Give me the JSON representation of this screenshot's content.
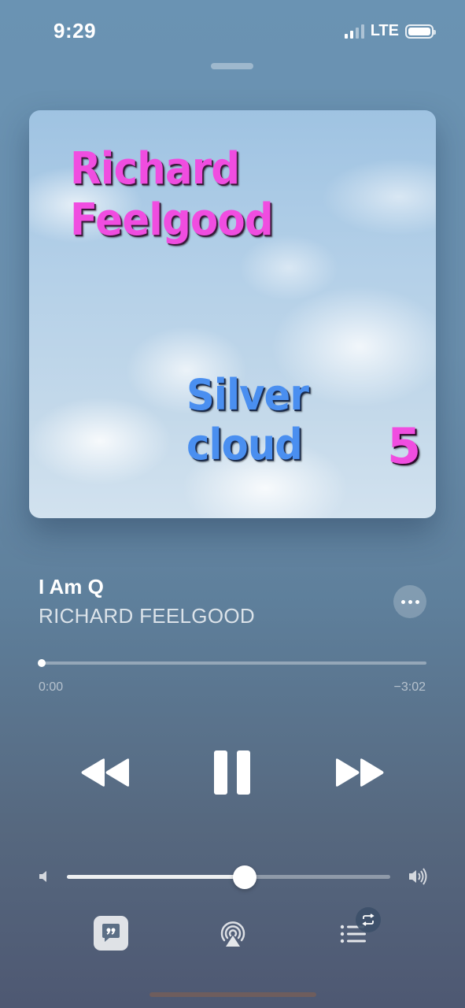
{
  "status_bar": {
    "time": "9:29",
    "network": "LTE",
    "signal_bars_filled": 2,
    "signal_bars_total": 4
  },
  "album_art": {
    "artist_text": "Richard Feelgood",
    "album_text": "Silver cloud",
    "volume_number": "5"
  },
  "now_playing": {
    "title": "I Am Q",
    "artist": "RICHARD FEELGOOD",
    "elapsed": "0:00",
    "remaining": "−3:02",
    "progress": 0.0
  },
  "volume": {
    "level": 0.55
  },
  "icons": {
    "more": "ellipsis-icon",
    "rewind": "rewind-icon",
    "pause": "pause-icon",
    "forward": "fast-forward-icon",
    "volume_low": "speaker-low-icon",
    "volume_high": "speaker-high-icon",
    "lyrics": "lyrics-quote-icon",
    "airplay": "airplay-icon",
    "queue": "queue-list-icon",
    "repeat": "repeat-icon"
  },
  "colors": {
    "art_title": "#f04de0",
    "art_subtitle": "#4a8ff0"
  }
}
